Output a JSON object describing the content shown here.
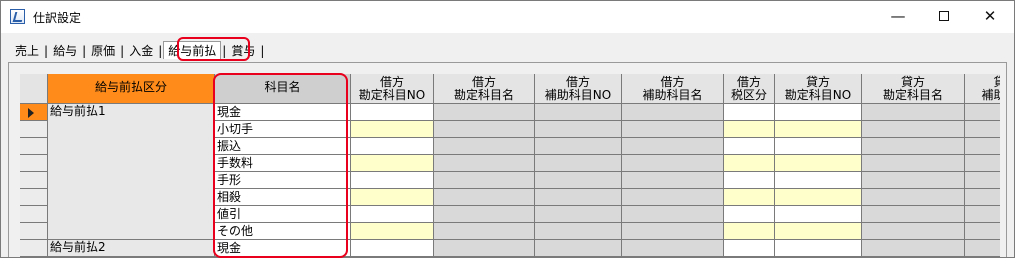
{
  "window": {
    "title": "仕訳設定",
    "minimize_glyph": "—",
    "close_glyph": "✕"
  },
  "tabs": [
    {
      "label": "売上"
    },
    {
      "label": "給与"
    },
    {
      "label": "原価"
    },
    {
      "label": "入金"
    },
    {
      "label": "給与前払",
      "active": true
    },
    {
      "label": "賞与"
    }
  ],
  "separator": "|",
  "grid": {
    "columns": [
      {
        "line1": "給与前払区分",
        "line2": ""
      },
      {
        "line1": "科目名",
        "line2": ""
      },
      {
        "line1": "借方",
        "line2": "勘定科目NO"
      },
      {
        "line1": "借方",
        "line2": "勘定科目名"
      },
      {
        "line1": "借方",
        "line2": "補助科目NO"
      },
      {
        "line1": "借方",
        "line2": "補助科目名"
      },
      {
        "line1": "借方",
        "line2": "税区分"
      },
      {
        "line1": "貸方",
        "line2": "勘定科目NO"
      },
      {
        "line1": "貸方",
        "line2": "勘定科目名"
      },
      {
        "line1": "貸",
        "line2": "補助科"
      }
    ],
    "groups": [
      "給与前払1",
      "給与前払2"
    ],
    "rows": [
      {
        "subject": "現金"
      },
      {
        "subject": "小切手"
      },
      {
        "subject": "振込"
      },
      {
        "subject": "手数料"
      },
      {
        "subject": "手形"
      },
      {
        "subject": "相殺"
      },
      {
        "subject": "値引"
      },
      {
        "subject": "その他"
      },
      {
        "subject": "現金"
      }
    ]
  },
  "colors": {
    "header_accent": "#ff8c1a",
    "highlight_red": "#e8001c",
    "input_yellow": "#ffffcc",
    "readonly_gray": "#d9d9d9"
  }
}
